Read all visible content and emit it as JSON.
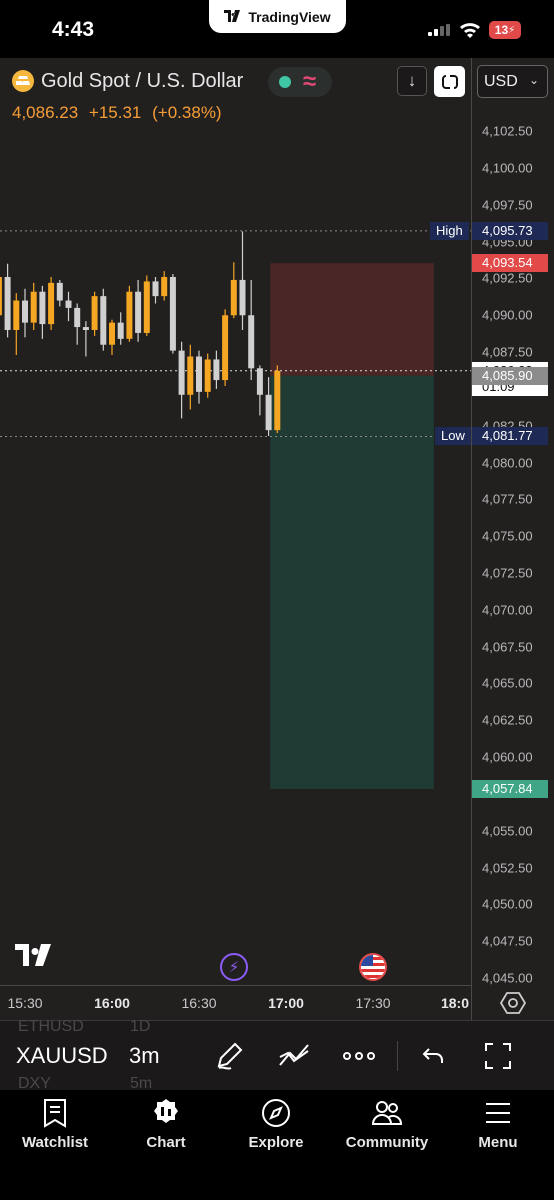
{
  "status_bar": {
    "time": "4:43",
    "brand": "TradingView",
    "battery": "13"
  },
  "header": {
    "title": "Gold Spot / U.S. Dollar",
    "price": "4,086.23",
    "change": "+15.31",
    "change_pct": "(+0.38%)",
    "currency": "USD"
  },
  "colors": {
    "up": "#f5a623",
    "down": "#d0d0d0",
    "profit_zone": "#1f3b34",
    "loss_zone": "#4a2626",
    "high_badge": "#1e2a55",
    "stop_badge": "#e24a4a",
    "target_badge": "#3fa586"
  },
  "price_axis": {
    "ticks": [
      "4,102.50",
      "4,100.00",
      "4,097.50",
      "4,095.00",
      "4,092.50",
      "4,090.00",
      "4,087.50",
      "4,082.50",
      "4,080.00",
      "4,077.50",
      "4,075.00",
      "4,072.50",
      "4,070.00",
      "4,067.50",
      "4,065.00",
      "4,062.50",
      "4,060.00",
      "4,055.00",
      "4,052.50",
      "4,050.00",
      "4,047.50",
      "4,045.00"
    ],
    "high_label": "High",
    "high_value": "4,095.73",
    "stop_value": "4,093.54",
    "current_value": "4,086.23",
    "countdown": "01:09",
    "entry_value": "4,085.90",
    "low_label": "Low",
    "low_value": "4,081.77",
    "target_value": "4,057.84"
  },
  "time_axis": {
    "labels": [
      {
        "text": "15:30",
        "bold": false
      },
      {
        "text": "16:00",
        "bold": true
      },
      {
        "text": "16:30",
        "bold": false
      },
      {
        "text": "17:00",
        "bold": true
      },
      {
        "text": "17:30",
        "bold": false
      },
      {
        "text": "18:0",
        "bold": true
      }
    ]
  },
  "toolbar": {
    "symbol": "XAUUSD",
    "interval": "3m",
    "ghost_symbol_top": "ETHUSD",
    "ghost_interval_top": "1D",
    "ghost_symbol_bottom": "DXY",
    "ghost_interval_bottom": "5m"
  },
  "tabs": [
    {
      "label": "Watchlist",
      "icon": "bookmark-list-icon"
    },
    {
      "label": "Chart",
      "icon": "candles-badge-icon"
    },
    {
      "label": "Explore",
      "icon": "compass-icon"
    },
    {
      "label": "Community",
      "icon": "people-icon"
    },
    {
      "label": "Menu",
      "icon": "hamburger-icon"
    }
  ],
  "chart_data": {
    "type": "candlestick",
    "interval": "3m",
    "candles": [
      {
        "t": "15:21",
        "o": 4090.0,
        "h": 4093.0,
        "l": 4087.0,
        "c": 4092.6
      },
      {
        "t": "15:24",
        "o": 4092.6,
        "h": 4093.5,
        "l": 4088.5,
        "c": 4089.0
      },
      {
        "t": "15:27",
        "o": 4089.0,
        "h": 4091.5,
        "l": 4087.3,
        "c": 4091.0
      },
      {
        "t": "15:30",
        "o": 4091.0,
        "h": 4091.8,
        "l": 4088.5,
        "c": 4089.5
      },
      {
        "t": "15:33",
        "o": 4089.5,
        "h": 4092.2,
        "l": 4089.0,
        "c": 4091.6
      },
      {
        "t": "15:36",
        "o": 4091.6,
        "h": 4092.0,
        "l": 4088.4,
        "c": 4089.4
      },
      {
        "t": "15:39",
        "o": 4089.4,
        "h": 4092.6,
        "l": 4089.0,
        "c": 4092.2
      },
      {
        "t": "15:42",
        "o": 4092.2,
        "h": 4092.4,
        "l": 4090.6,
        "c": 4091.0
      },
      {
        "t": "15:45",
        "o": 4091.0,
        "h": 4091.6,
        "l": 4089.6,
        "c": 4090.5
      },
      {
        "t": "15:48",
        "o": 4090.5,
        "h": 4090.8,
        "l": 4088.0,
        "c": 4089.2
      },
      {
        "t": "15:51",
        "o": 4089.2,
        "h": 4089.6,
        "l": 4087.2,
        "c": 4089.0
      },
      {
        "t": "15:54",
        "o": 4089.0,
        "h": 4091.6,
        "l": 4088.6,
        "c": 4091.3
      },
      {
        "t": "15:57",
        "o": 4091.3,
        "h": 4091.8,
        "l": 4087.6,
        "c": 4088.0
      },
      {
        "t": "16:00",
        "o": 4088.0,
        "h": 4089.7,
        "l": 4087.3,
        "c": 4089.5
      },
      {
        "t": "16:03",
        "o": 4089.5,
        "h": 4090.2,
        "l": 4088.0,
        "c": 4088.4
      },
      {
        "t": "16:06",
        "o": 4088.4,
        "h": 4092.0,
        "l": 4088.2,
        "c": 4091.6
      },
      {
        "t": "16:09",
        "o": 4091.6,
        "h": 4092.4,
        "l": 4088.2,
        "c": 4088.8
      },
      {
        "t": "16:12",
        "o": 4088.8,
        "h": 4092.7,
        "l": 4088.6,
        "c": 4092.3
      },
      {
        "t": "16:15",
        "o": 4092.3,
        "h": 4092.6,
        "l": 4090.8,
        "c": 4091.3
      },
      {
        "t": "16:18",
        "o": 4091.3,
        "h": 4093.0,
        "l": 4091.0,
        "c": 4092.6
      },
      {
        "t": "16:21",
        "o": 4092.6,
        "h": 4092.8,
        "l": 4087.4,
        "c": 4087.6
      },
      {
        "t": "16:24",
        "o": 4087.6,
        "h": 4088.2,
        "l": 4083.0,
        "c": 4084.6
      },
      {
        "t": "16:27",
        "o": 4084.6,
        "h": 4088.0,
        "l": 4083.6,
        "c": 4087.2
      },
      {
        "t": "16:30",
        "o": 4087.2,
        "h": 4087.6,
        "l": 4084.0,
        "c": 4084.8
      },
      {
        "t": "16:33",
        "o": 4084.8,
        "h": 4087.4,
        "l": 4084.4,
        "c": 4087.0
      },
      {
        "t": "16:36",
        "o": 4087.0,
        "h": 4087.6,
        "l": 4085.0,
        "c": 4085.6
      },
      {
        "t": "16:39",
        "o": 4085.6,
        "h": 4090.4,
        "l": 4085.2,
        "c": 4090.0
      },
      {
        "t": "16:42",
        "o": 4090.0,
        "h": 4093.6,
        "l": 4089.8,
        "c": 4092.4
      },
      {
        "t": "16:45",
        "o": 4092.4,
        "h": 4095.7,
        "l": 4089.0,
        "c": 4090.0
      },
      {
        "t": "16:48",
        "o": 4090.0,
        "h": 4092.4,
        "l": 4085.6,
        "c": 4086.4
      },
      {
        "t": "16:51",
        "o": 4086.4,
        "h": 4086.6,
        "l": 4083.2,
        "c": 4084.6
      },
      {
        "t": "16:54",
        "o": 4084.6,
        "h": 4085.8,
        "l": 4081.8,
        "c": 4082.2
      },
      {
        "t": "16:57",
        "o": 4082.2,
        "h": 4086.6,
        "l": 4082.0,
        "c": 4086.23
      }
    ],
    "position": {
      "type": "short",
      "entry": 4085.9,
      "stop": 4093.54,
      "target": 4057.84,
      "start_time": "16:57",
      "end_time": "17:51"
    },
    "high": 4095.73,
    "low": 4081.77,
    "ylim": [
      4044.0,
      4106.0
    ]
  }
}
